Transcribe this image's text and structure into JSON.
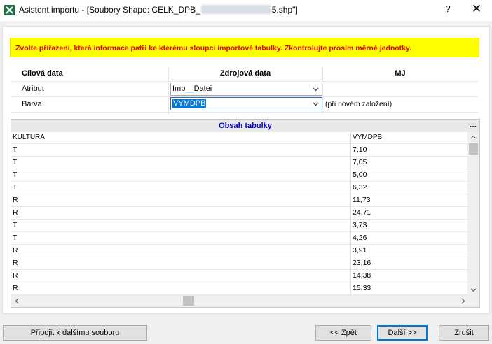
{
  "window": {
    "title_prefix": "Asistent importu - [Soubory Shape: CELK_DPB_",
    "title_suffix": "5.shp\"]",
    "help_label": "?",
    "close_label": "✕",
    "app_icon": "excel-icon"
  },
  "warning": {
    "text": "Zvolte přiřazení, která informace patří ke kterému sloupci importové tabulky. Zkontrolujte prosím měrné jednotky."
  },
  "mapping": {
    "headers": {
      "target": "Cílová data",
      "source": "Zdrojová data",
      "unit": "MJ"
    },
    "rows": [
      {
        "label": "Atribut",
        "value": "Imp__Datei",
        "unit": ""
      },
      {
        "label": "Barva",
        "value": "VYMDPB",
        "unit": "(při novém založení)"
      }
    ]
  },
  "table": {
    "caption": "Obsah tabulky",
    "more_label": "...",
    "columns": [
      "KULTURA",
      "VYMDPB"
    ],
    "rows": [
      [
        "T",
        "7,10"
      ],
      [
        "T",
        "7,05"
      ],
      [
        "T",
        "5,00"
      ],
      [
        "T",
        "6,32"
      ],
      [
        "R",
        "11,73"
      ],
      [
        "R",
        "24,71"
      ],
      [
        "T",
        "3,73"
      ],
      [
        "T",
        "4,26"
      ],
      [
        "R",
        "3,91"
      ],
      [
        "R",
        "23,16"
      ],
      [
        "R",
        "14,38"
      ],
      [
        "R",
        "15,33"
      ]
    ]
  },
  "buttons": {
    "append": "Připojit k dalšímu souboru",
    "back": "<< Zpět",
    "next": "Další >>",
    "cancel": "Zrušit"
  },
  "colors": {
    "warning_bg": "#ffff00",
    "warning_text": "#e00000",
    "caption_text": "#0000c8",
    "selection": "#0078d7"
  }
}
